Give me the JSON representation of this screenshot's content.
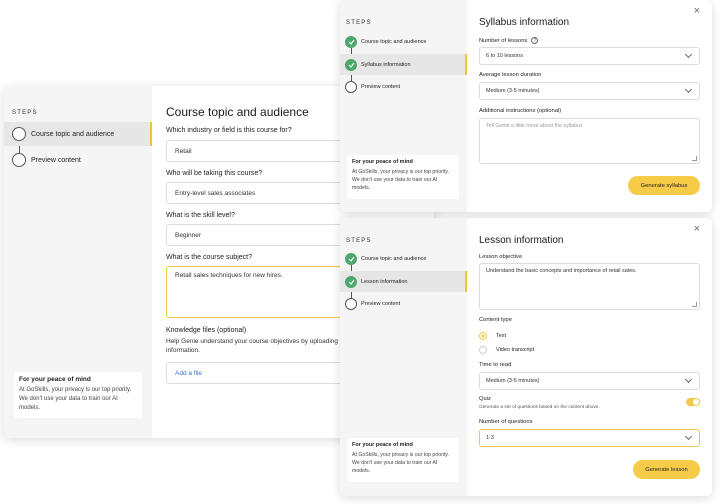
{
  "course_card": {
    "steps_heading": "STEPS",
    "steps": [
      "Course topic and audience",
      "Preview content"
    ],
    "title": "Course topic and audience",
    "industry_label": "Which industry or field is this course for?",
    "industry_value": "Retail",
    "audience_label": "Who will be taking this course?",
    "audience_value": "Entry-level sales associates",
    "skill_label": "What is the skill level?",
    "skill_value": "Beginner",
    "subject_label": "What is the course subject?",
    "subject_value": "Retail sales techniques for new hires.",
    "knowledge_label": "Knowledge files (optional)",
    "knowledge_help": "Help Genie understand your course objectives by uploading",
    "knowledge_help_2": "information.",
    "add_file": "Add a file",
    "privacy_title": "For your peace of mind",
    "privacy_body": "At GoSkills, your privacy is our top priority. We don't use your data to train our AI models."
  },
  "syllabus_card": {
    "steps_heading": "STEPS",
    "steps": [
      "Course topic and audience",
      "Syllabus information",
      "Preview content"
    ],
    "title": "Syllabus information",
    "lessons_label": "Number of lessons",
    "lessons_value": "6 to 10 lessons",
    "duration_label": "Average lesson duration",
    "duration_value": "Medium (3-5 minutes)",
    "instructions_label": "Additional instructions (optional)",
    "instructions_placeholder": "Tell Genie a little more about the syllabus",
    "generate_button": "Generate syllabus",
    "close": "×",
    "privacy_title": "For your peace of mind",
    "privacy_body": "At GoSkills, your privacy is our top priority. We don't use your data to train our AI models."
  },
  "lesson_card": {
    "steps_heading": "STEPS",
    "steps": [
      "Course topic and audience",
      "Lesson information",
      "Preview content"
    ],
    "title": "Lesson information",
    "objective_label": "Lesson objective",
    "objective_value": "Understand the basic concepts and importance of retail sales.",
    "content_type_label": "Content type",
    "content_type_options": [
      "Text",
      "Video transcript"
    ],
    "time_label": "Time to read",
    "time_value": "Medium (3-5 minutes)",
    "quiz_label": "Quiz",
    "quiz_help": "Generate a set of questions based on the content above.",
    "questions_label": "Number of questions",
    "questions_value": "1-3",
    "generate_button": "Generate lesson",
    "close": "×",
    "privacy_title": "For your peace of mind",
    "privacy_body": "At GoSkills, your privacy is our top priority. We don't use your data to train our AI models."
  },
  "colors": {
    "accent": "#f5cb48",
    "done_step": "#4aa86b",
    "link": "#3a6fd8"
  }
}
